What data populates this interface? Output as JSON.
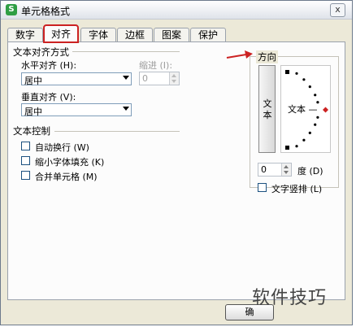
{
  "window": {
    "title": "单元格格式",
    "app_icon_letter": "S",
    "close_glyph": "x"
  },
  "tabs": [
    {
      "label": "数字",
      "active": false
    },
    {
      "label": "对齐",
      "active": true
    },
    {
      "label": "字体",
      "active": false
    },
    {
      "label": "边框",
      "active": false
    },
    {
      "label": "图案",
      "active": false
    },
    {
      "label": "保护",
      "active": false
    }
  ],
  "alignment": {
    "group_label": "文本对齐方式",
    "horizontal": {
      "label": "水平对齐 (H):",
      "value": "居中"
    },
    "indent": {
      "label": "缩进 (I):",
      "value": "0",
      "disabled": true
    },
    "vertical": {
      "label": "垂直对齐 (V):",
      "value": "居中"
    }
  },
  "text_control": {
    "group_label": "文本控制",
    "options": [
      {
        "label": "自动换行 (W)",
        "checked": false
      },
      {
        "label": "缩小字体填充 (K)",
        "checked": false
      },
      {
        "label": "合并单元格 (M)",
        "checked": false
      }
    ]
  },
  "orientation": {
    "group_label": "方向",
    "vertical_text_button": "文本",
    "dial_text": "文本 —",
    "degrees_value": "0",
    "degrees_label": "度 (D)",
    "vertical_layout": {
      "label": "文字竖排 (L)",
      "checked": false
    }
  },
  "buttons": {
    "ok_partial": "确"
  },
  "watermark": "软件技巧",
  "colors": {
    "highlight": "#cc2222",
    "dialog_bg": "#ece9d8"
  }
}
